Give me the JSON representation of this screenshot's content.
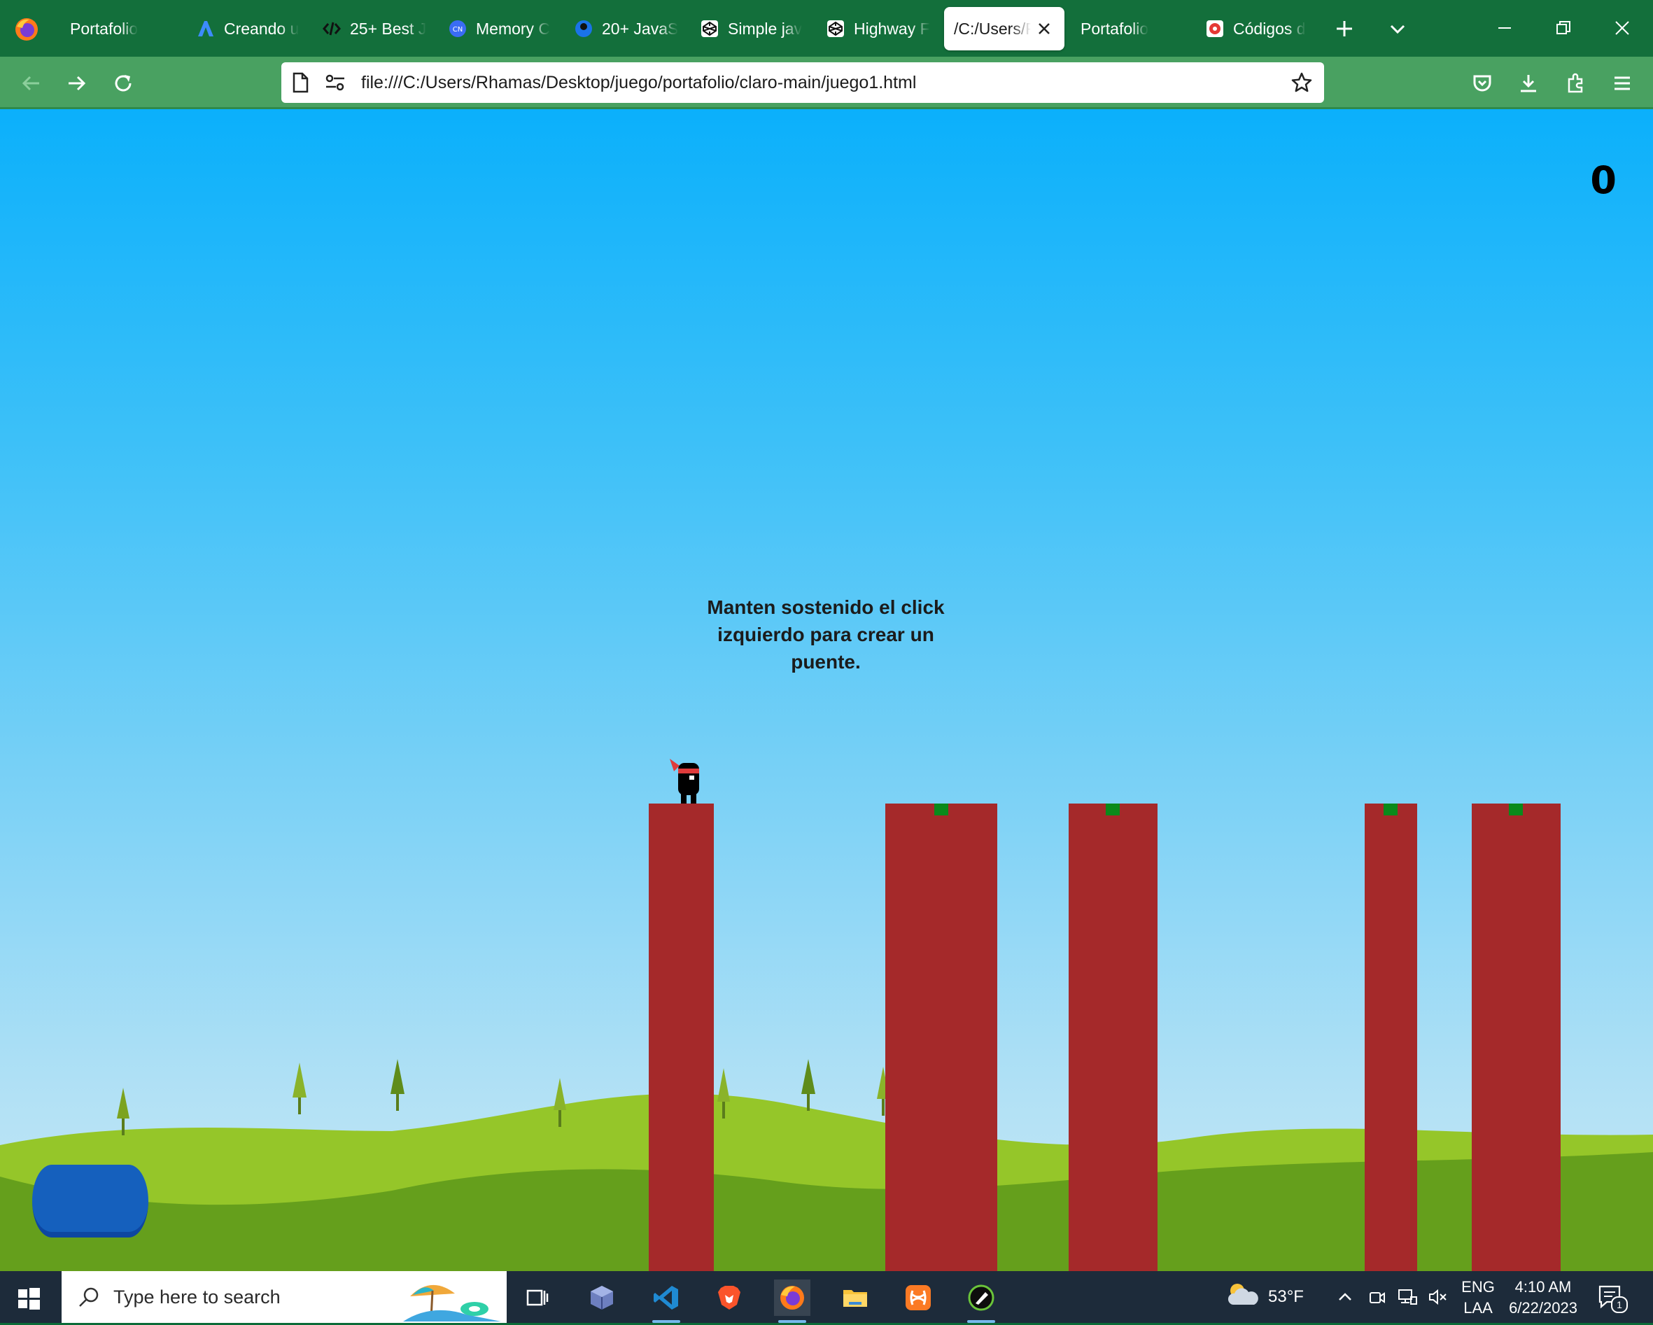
{
  "browser": {
    "tabs": [
      {
        "label": "Portafolio",
        "icon": "globe-icon"
      },
      {
        "label": "Creando u",
        "icon": "mountain-icon"
      },
      {
        "label": "25+ Best J",
        "icon": "code-icon"
      },
      {
        "label": "Memory C",
        "icon": "codenewbie-icon"
      },
      {
        "label": "20+ JavaS",
        "icon": "site-icon"
      },
      {
        "label": "Simple jav",
        "icon": "codepen-icon"
      },
      {
        "label": "Highway F",
        "icon": "codepen-icon"
      },
      {
        "label": "/C:/Users/R",
        "icon": "",
        "active": true
      },
      {
        "label": "Portafolio",
        "icon": ""
      },
      {
        "label": "Códigos d",
        "icon": "site-icon"
      }
    ],
    "url": "file:///C:/Users/Rhamas/Desktop/juego/portafolio/claro-main/juego1.html",
    "colors": {
      "tabstrip": "#136f3b",
      "navbar": "#49a161"
    }
  },
  "game": {
    "score": "0",
    "introduction": "Manten sostenido el click izquierdo para crear un puente.",
    "colors": {
      "platform": "#a5292a",
      "perfect_area": "#0a8a1b",
      "sky_top": "#0bb0fb",
      "sky_bottom": "#c7e8f4",
      "hill_light": "#95c629",
      "hill_dark": "#659f1c",
      "restart_button": "#1560bd"
    }
  },
  "taskbar": {
    "search_placeholder": "Type here to search",
    "weather": "53°F",
    "language_line1": "ENG",
    "language_line2": "LAA",
    "time": "4:10 AM",
    "date": "6/22/2023",
    "notifications": "1"
  }
}
